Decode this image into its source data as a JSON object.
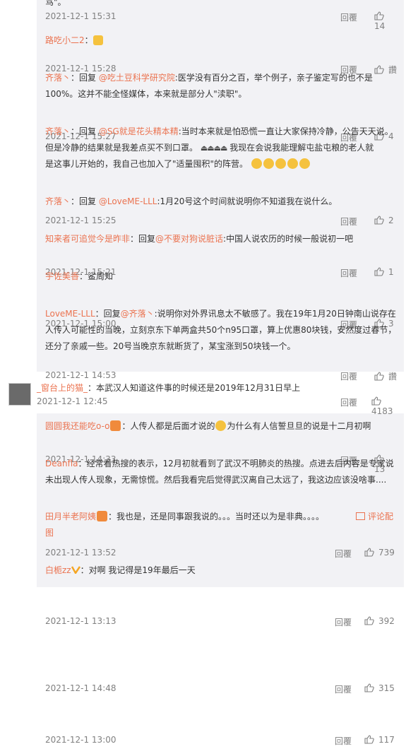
{
  "block1": [
    {
      "text_html_note": "",
      "user": "",
      "content": "",
      "time": "2021-12-1 15:31",
      "reply": "回覆",
      "likes": "14"
    },
    {
      "user": "路吃小二2",
      "sep": "：",
      "time": "2021-12-1 15:28",
      "reply": "回覆",
      "likes": "讚"
    },
    {
      "user": "齐落丶",
      "mid": "：回复 ",
      "at": "@吃土豆科学研究院",
      "content": ":医学没有百分之百，举个例子，亲子鉴定写的也不是",
      "content2": "100%。这并不能全怪媒体，本来就是部分人\"渎职\"。",
      "time": "2021-12-1 15:27",
      "reply": "回覆",
      "likes": "4"
    },
    {
      "user": "齐落丶",
      "mid": "：回复 ",
      "at": "@SG就是花头精本精",
      "content": ":当时本来就是怕恐慌一直让大家保持冷静，公告天天说。",
      "content2": "但是冷静的结果就是我差点买不到口罩。",
      "content3": "我现在会说我能理解屯盐屯粮的老人就",
      "content4": "是这事儿开始的，我自己也加入了\"适量囤积\"的阵营。",
      "time": "2021-12-1 15:25",
      "reply": "回覆",
      "likes": "2"
    },
    {
      "user": "齐落丶",
      "mid": "：回复 ",
      "at": "@LoveME-LLL",
      "content": ":1月20号这个时间就说明你不知道我在说什么。",
      "time": "2021-12-1 15:21",
      "reply": "回覆",
      "likes": "1"
    },
    {
      "user": "知来者可追觉今是昨非",
      "mid": "：回复",
      "at": "@不要对狗说脏话",
      "content": ":中国人说农历的时候一般说初一吧",
      "time": "2021-12-1 15:00",
      "reply": "回覆",
      "likes": "3"
    },
    {
      "user": "宇佐美香",
      "content": "：鲨周知",
      "time": "2021-12-1 14:53",
      "reply": "回覆",
      "likes": "讚"
    },
    {
      "user": "LoveME-LLL",
      "mid": "：回复",
      "at": "@齐落丶",
      "content": ":说明你对外界讯息太不敏感了。我在19年1月20日钟南山说存在",
      "content2": "人传人可能性的当晚，立刻京东下单两盒共50个n95口罩，算上优惠80块钱，安然度过春节，",
      "content3": "还分了亲戚一些。20号当晚京东就断货了，某宝涨到50块钱一个。",
      "time": "2021-12-1 14:33",
      "reply": "回覆",
      "likes": "13"
    }
  ],
  "top_comment": {
    "user": "_窗台上的猫_",
    "content": "：本武汉人知道这件事的时候还是2019年12月31日早上",
    "time": "2021-12-1 12:45",
    "reply": "回覆",
    "likes": "4183"
  },
  "block2": [
    {
      "user": "圆圆我还能吃o-o",
      "content": "：人传人都是后面才说的",
      "content2": "为什么有人信誓旦旦的说是十二月初啊",
      "time": "2021-12-1 13:52",
      "reply": "回覆",
      "likes": "739"
    },
    {
      "user": "Deanfla",
      "content": "：经常看热搜的表示，12月初就看到了武汉不明肺炎的热搜。点进去后内容是专家说",
      "content2": "未出现人传人现象，无需惊慌。然后我看完后觉得武汉离自己太远了，我这边应该没啥事....",
      "time": "2021-12-1 13:13",
      "reply": "回覆",
      "likes": "392"
    },
    {
      "user": "田月半老阿姨",
      "content": "：我也是，还是同事跟我说的。。。当时还以为是非典。。。。",
      "image_comment": "评论配",
      "image_comment2": "图",
      "time": "2021-12-1 14:48",
      "reply": "回覆",
      "likes": "315"
    },
    {
      "user": "白栀zz",
      "content": "：对啊 我记得是19年最后一天",
      "time": "2021-12-1 13:00",
      "reply": "回覆",
      "likes": "117"
    }
  ],
  "first_line_text": "骂\"。",
  "emoji_candle": "🕯",
  "colors": {
    "username": "#eb7350",
    "meta": "#808080",
    "bg_block": "#f2f2f5"
  }
}
